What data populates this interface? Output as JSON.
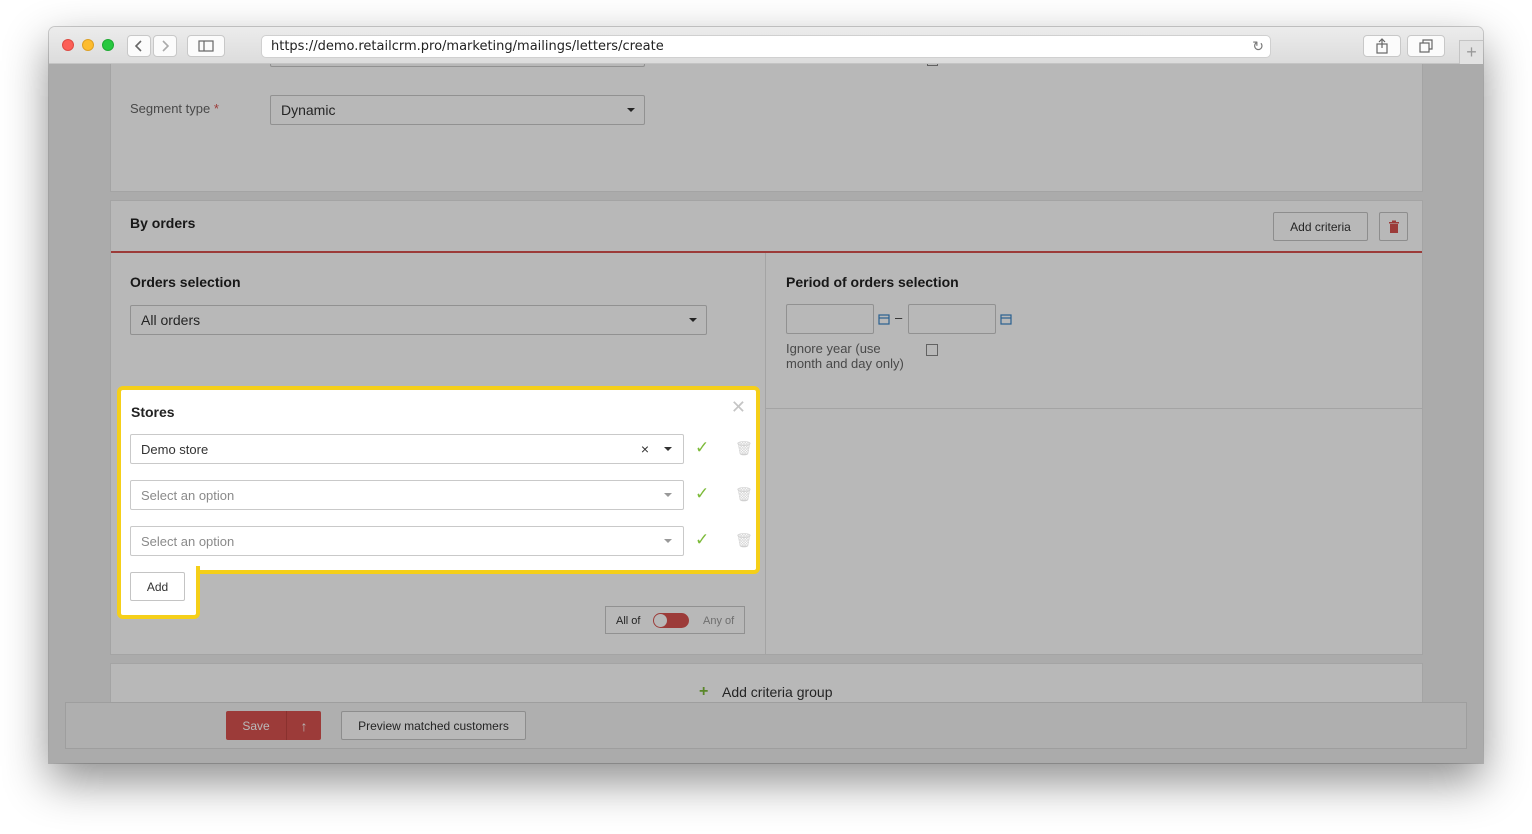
{
  "browser": {
    "url": "https://demo.retailcrm.pro/marketing/mailings/letters/create",
    "back_icon": "chevron-left-icon",
    "forward_icon": "chevron-right-icon",
    "sidebar_icon": "sidebar-icon",
    "reload_icon": "reload-icon",
    "share_icon": "share-icon",
    "tabs_icon": "tabs-icon",
    "new_tab_icon": "plus-icon"
  },
  "segment": {
    "segment_type_label": "Segment type",
    "required_mark": "*",
    "segment_type_value": "Dynamic"
  },
  "by_orders": {
    "title": "By orders",
    "add_criteria_label": "Add criteria",
    "orders_selection_title": "Orders selection",
    "orders_selection_value": "All orders",
    "period_title": "Period of orders selection",
    "period_separator": "–",
    "ignore_year_line1": "Ignore year (use",
    "ignore_year_line2": "month and day only)"
  },
  "stores_popup": {
    "title": "Stores",
    "rows": [
      {
        "value": "Demo store",
        "placeholder": false
      },
      {
        "value": "Select an option",
        "placeholder": true
      },
      {
        "value": "Select an option",
        "placeholder": true
      }
    ],
    "add_label": "Add",
    "all_of_label": "All of",
    "any_of_label": "Any of"
  },
  "add_criteria_group_label": "Add criteria group",
  "footer": {
    "save_label": "Save",
    "preview_label": "Preview matched customers"
  },
  "colors": {
    "highlight": "#f5cf19",
    "danger": "#d9534f",
    "success": "#7dbb3a"
  }
}
